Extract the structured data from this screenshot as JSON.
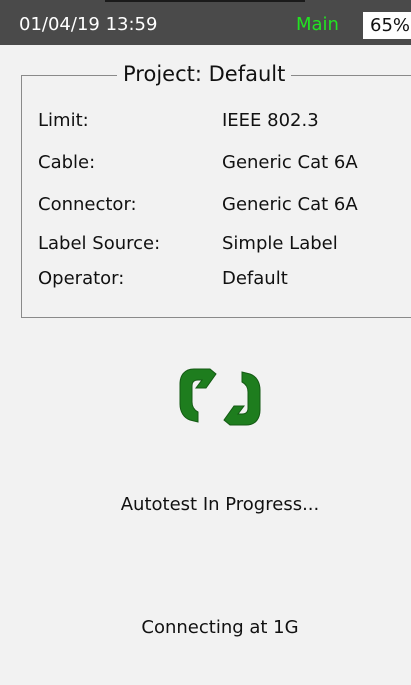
{
  "status_bar": {
    "datetime": "01/04/19 13:59",
    "mode": "Main",
    "battery": "65%"
  },
  "project": {
    "title": "Project: Default",
    "rows": [
      {
        "label": "Limit:",
        "value": "IEEE 802.3"
      },
      {
        "label": "Cable:",
        "value": "Generic Cat 6A"
      },
      {
        "label": "Connector:",
        "value": "Generic Cat 6A"
      },
      {
        "label": "Label Source:",
        "value": "Simple Label"
      },
      {
        "label": "Operator:",
        "value": "Default"
      }
    ]
  },
  "status": {
    "icon": "sync-icon",
    "icon_color": "#1e7d1e",
    "progress": "Autotest In Progress...",
    "connection": "Connecting at 1G"
  },
  "colors": {
    "status_bar_bg": "#4a4a4a",
    "mode_text": "#22e322",
    "background": "#f2f2f2"
  }
}
